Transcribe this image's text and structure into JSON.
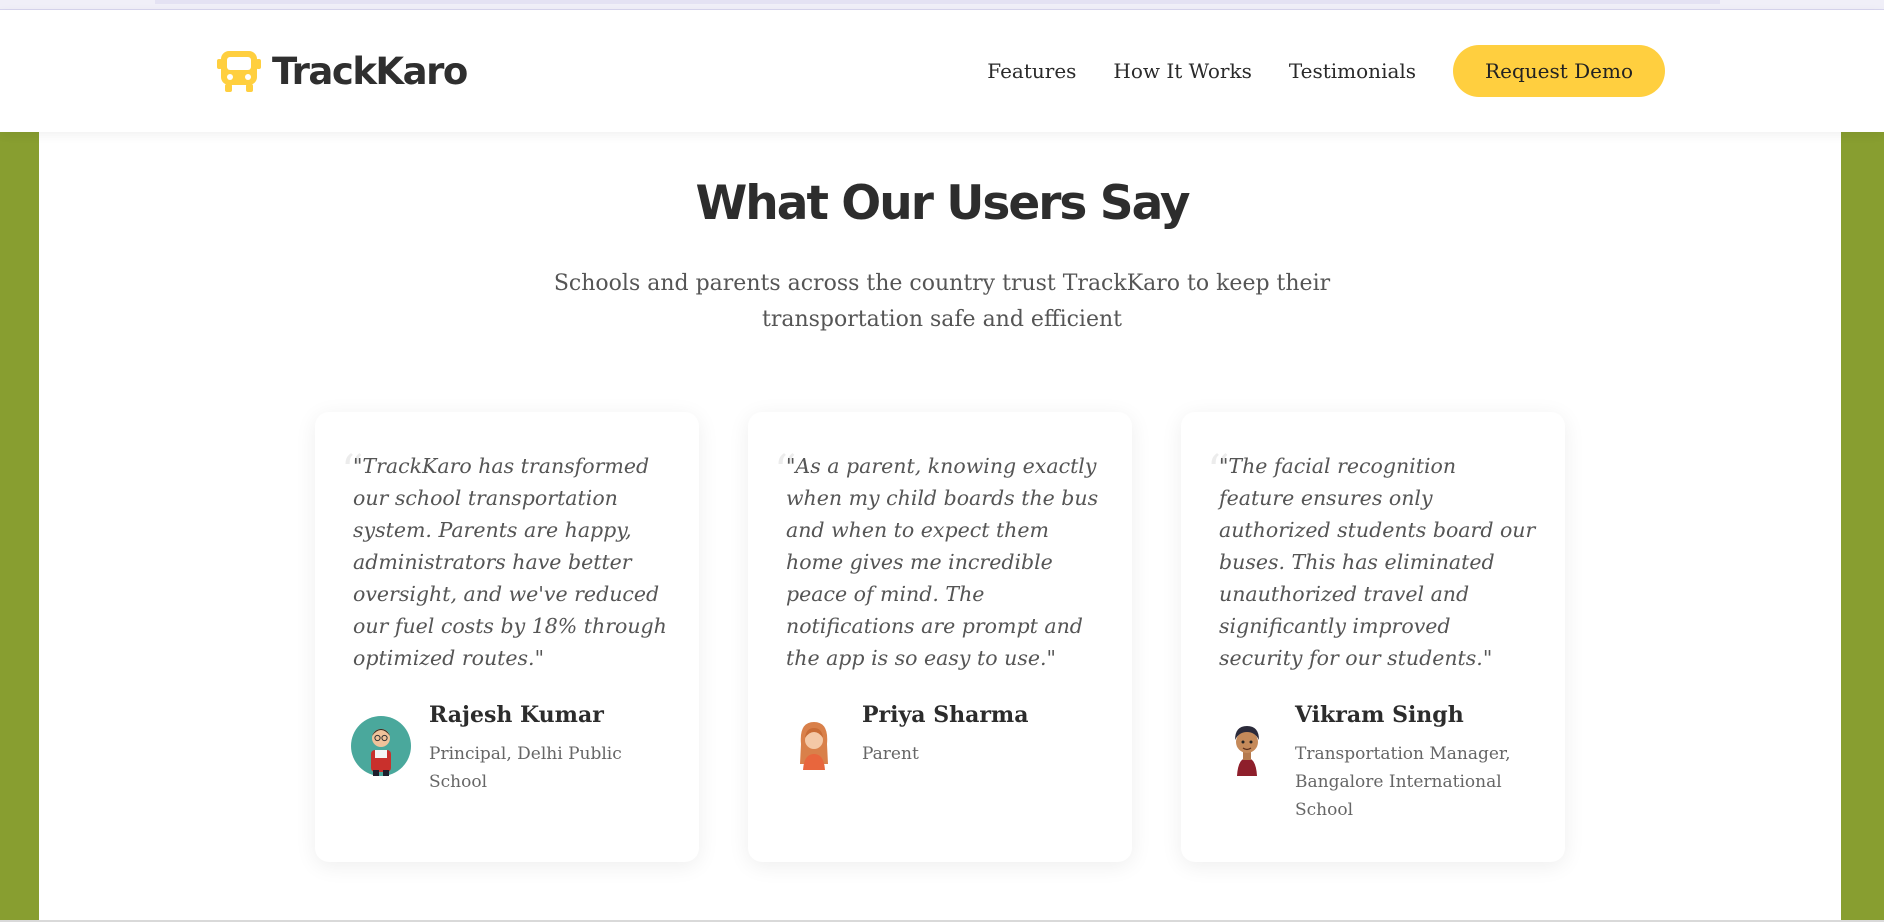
{
  "brand": {
    "name": "TrackKaro",
    "accent": "#ffcf3f",
    "side_color": "#889e30",
    "logo_icon": "bus-icon"
  },
  "nav": {
    "links": [
      "Features",
      "How It Works",
      "Testimonials"
    ],
    "cta": "Request Demo"
  },
  "section": {
    "title": "What Our Users Say",
    "subtitle": "Schools and parents across the country trust TrackKaro to keep their transportation safe and efficient"
  },
  "testimonials": [
    {
      "quote": "\"TrackKaro has transformed our school transportation system. Parents are happy, administrators have better oversight, and we've reduced our fuel costs by 18% through optimized routes.\"",
      "name": "Rajesh Kumar",
      "role": "Principal, Delhi Public School",
      "avatar": "man-avatar-icon"
    },
    {
      "quote": "\"As a parent, knowing exactly when my child boards the bus and when to expect them home gives me incredible peace of mind. The notifications are prompt and the app is so easy to use.\"",
      "name": "Priya Sharma",
      "role": "Parent",
      "avatar": "woman-avatar-icon"
    },
    {
      "quote": "\"The facial recognition feature ensures only authorized students board our buses. This has eliminated unauthorized travel and significantly improved security for our students.\"",
      "name": "Vikram Singh",
      "role": "Transportation Manager, Bangalore International School",
      "avatar": "man-avatar-icon"
    }
  ]
}
